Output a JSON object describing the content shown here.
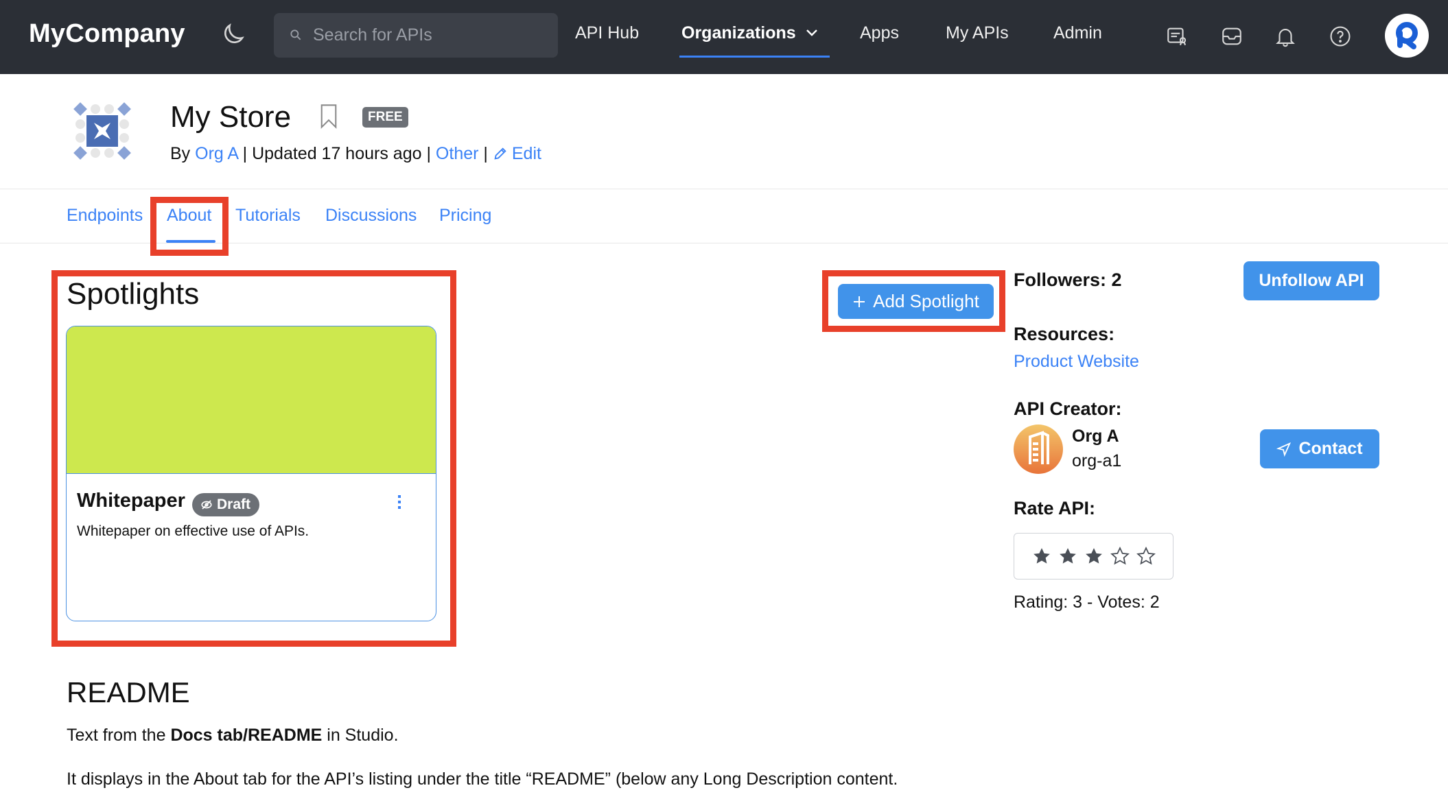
{
  "nav": {
    "brand": "MyCompany",
    "search_placeholder": "Search for APIs",
    "links": [
      {
        "label": "API Hub",
        "active": false
      },
      {
        "label": "Organizations",
        "active": true,
        "has_dropdown": true
      },
      {
        "label": "Apps",
        "active": false
      },
      {
        "label": "My APIs",
        "active": false
      },
      {
        "label": "Admin",
        "active": false
      }
    ],
    "icons": [
      "theme-toggle-moon-icon",
      "certificate-icon",
      "inbox-icon",
      "bell-icon",
      "help-icon"
    ],
    "avatar_icon": "user-avatar-logo"
  },
  "api": {
    "title": "My Store",
    "badge": "FREE",
    "by_label": "By",
    "org": "Org A",
    "updated": "Updated 17 hours ago",
    "category": "Other",
    "edit_label": "Edit",
    "separator": "|"
  },
  "tabs": [
    {
      "label": "Endpoints",
      "active": false
    },
    {
      "label": "About",
      "active": true
    },
    {
      "label": "Tutorials",
      "active": false
    },
    {
      "label": "Discussions",
      "active": false
    },
    {
      "label": "Pricing",
      "active": false
    }
  ],
  "spotlights": {
    "title": "Spotlights",
    "add_button": "Add Spotlight",
    "cards": [
      {
        "title": "Whitepaper",
        "status": "Draft",
        "description": "Whitepaper on effective use of APIs.",
        "image_color": "#cde84e"
      }
    ]
  },
  "sidebar": {
    "followers_label": "Followers: 2",
    "unfollow_button": "Unfollow API",
    "resources_label": "Resources:",
    "resource_link": "Product Website",
    "creator_label": "API Creator:",
    "creator_name": "Org A",
    "creator_handle": "org-a1",
    "contact_button": "Contact",
    "rate_label": "Rate API:",
    "rating": 3,
    "max_rating": 5,
    "rating_text": "Rating: 3 - Votes: 2"
  },
  "readme": {
    "title": "README",
    "p1_pre": "Text from the ",
    "p1_bold": "Docs tab/README",
    "p1_post": " in Studio.",
    "p2": "It displays in the About tab for the API’s listing under the title “README” (below any Long Description content."
  },
  "colors": {
    "nav_bg": "#2b2f36",
    "accent": "#3b82f6",
    "button": "#4193ea",
    "annotation": "#e8402a",
    "badge_gray": "#6c7076"
  }
}
